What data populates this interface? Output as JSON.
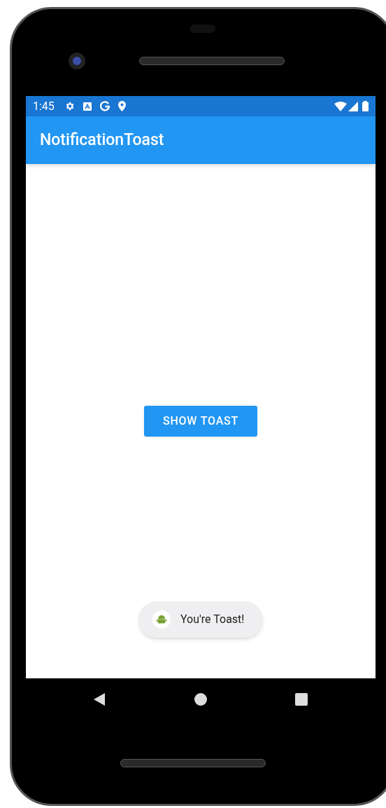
{
  "status_bar": {
    "time": "1:45"
  },
  "app_bar": {
    "title": "NotificationToast"
  },
  "button": {
    "label": "SHOW TOAST"
  },
  "toast": {
    "message": "You're Toast!"
  }
}
